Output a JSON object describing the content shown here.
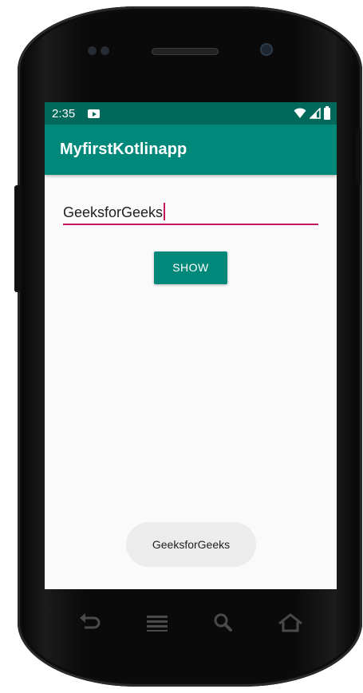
{
  "status_bar": {
    "time": "2:35",
    "icons": [
      "media-notification-icon",
      "wifi-icon",
      "cell-signal-icon",
      "battery-icon"
    ]
  },
  "app_bar": {
    "title": "MyfirstKotlinapp"
  },
  "edit_text": {
    "value": "GeeksforGeeks"
  },
  "show_button": {
    "label": "SHOW"
  },
  "toast": {
    "message": "GeeksforGeeks"
  },
  "hardware_keys": [
    "back-icon",
    "menu-icon",
    "search-icon",
    "home-icon"
  ],
  "colors": {
    "status_bar": "#00695c",
    "app_bar": "#00897b",
    "accent": "#c2185b",
    "button": "#00897b",
    "toast_bg": "#ececec"
  }
}
